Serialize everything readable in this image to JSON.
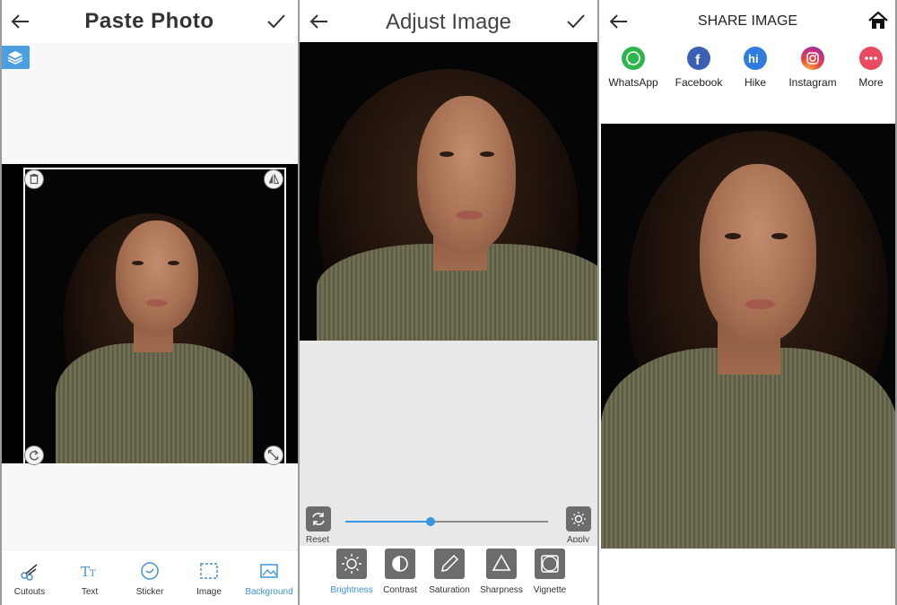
{
  "screen1": {
    "title": "Paste Photo",
    "tools": [
      {
        "label": "Cutouts",
        "icon": "scissors-icon"
      },
      {
        "label": "Text",
        "icon": "text-icon"
      },
      {
        "label": "Sticker",
        "icon": "sticker-icon"
      },
      {
        "label": "Image",
        "icon": "image-frame-icon"
      },
      {
        "label": "Background",
        "icon": "background-image-icon"
      }
    ],
    "active_tool": "Background"
  },
  "screen2": {
    "title": "Adjust Image",
    "reset_label": "Reset",
    "apply_label": "Apply",
    "slider_value": 0.42,
    "tools": [
      {
        "label": "Brightness",
        "icon": "brightness-icon"
      },
      {
        "label": "Contrast",
        "icon": "contrast-icon"
      },
      {
        "label": "Saturation",
        "icon": "dropper-icon"
      },
      {
        "label": "Sharpness",
        "icon": "triangle-icon"
      },
      {
        "label": "Vignette",
        "icon": "vignette-icon"
      }
    ],
    "active_tool": "Brightness"
  },
  "screen3": {
    "title": "SHARE IMAGE",
    "share_targets": [
      {
        "label": "WhatsApp",
        "icon": "whatsapp-icon",
        "color": "#2fb54c"
      },
      {
        "label": "Facebook",
        "icon": "facebook-icon",
        "color": "#3b5fb5"
      },
      {
        "label": "Hike",
        "icon": "hike-icon",
        "color": "#2f7be0"
      },
      {
        "label": "Instagram",
        "icon": "instagram-icon",
        "color": "#c2307e"
      },
      {
        "label": "More",
        "icon": "more-icon",
        "color": "#ea4a5f"
      }
    ]
  },
  "colors": {
    "accent": "#3a95dd",
    "tool_box": "#6c6c6c"
  }
}
